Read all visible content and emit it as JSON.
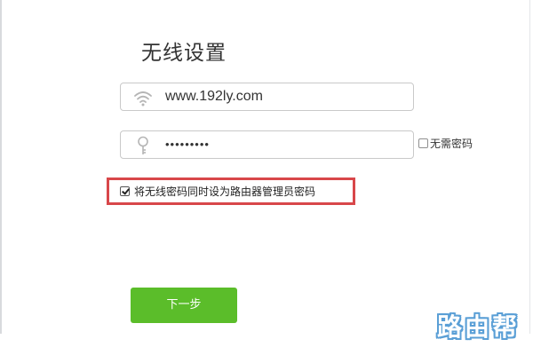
{
  "page": {
    "title": "无线设置"
  },
  "wireless": {
    "ssid": {
      "icon": "wifi-icon",
      "value": "www.192ly.com"
    },
    "password": {
      "icon": "key-icon",
      "value": "•••••••••"
    },
    "no_password": {
      "label": "无需密码",
      "checked": false
    },
    "sync_admin": {
      "label": "将无线密码同时设为路由器管理员密码",
      "checked": true
    }
  },
  "actions": {
    "next_label": "下一步"
  },
  "watermark": {
    "text": "路由帮"
  },
  "colors": {
    "accent_green": "#5bbd2a",
    "highlight_red": "#d8474a",
    "watermark_blue": "#5a9fd6"
  }
}
